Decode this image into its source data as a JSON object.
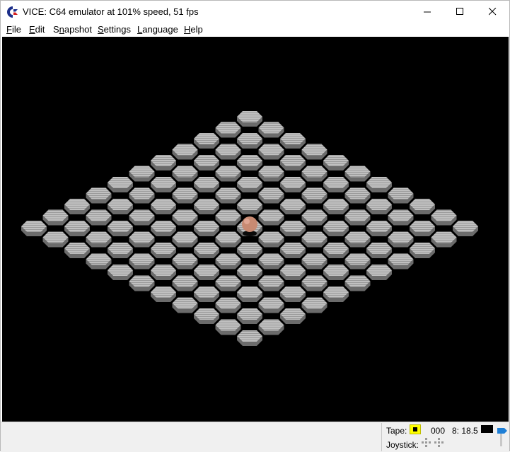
{
  "window": {
    "title": "VICE: C64 emulator at 101% speed, 51 fps",
    "app_icon": "commodore-logo-icon",
    "controls": [
      "minimize-icon",
      "maximize-icon",
      "close-icon"
    ]
  },
  "menu": {
    "items": [
      {
        "label": "File",
        "accel": "F"
      },
      {
        "label": "Edit",
        "accel": "E"
      },
      {
        "label": "Snapshot",
        "accel": "n"
      },
      {
        "label": "Settings",
        "accel": "S"
      },
      {
        "label": "Language",
        "accel": "L"
      },
      {
        "label": "Help",
        "accel": "H"
      }
    ]
  },
  "emulator_screen": {
    "background": "#000000",
    "tile_color": "#b8b8b8",
    "ball_color": "#c88a72",
    "grid_rows": 11,
    "grid_cols": 11
  },
  "status": {
    "tape_label": "Tape:",
    "tape_counter": "000",
    "drive_status": "8: 18.5",
    "joystick_label": "Joystick:",
    "tape_indicator_color": "#ffff00",
    "drive_led_color": "#000000",
    "speed_flag_color": "#1e7fd6"
  }
}
